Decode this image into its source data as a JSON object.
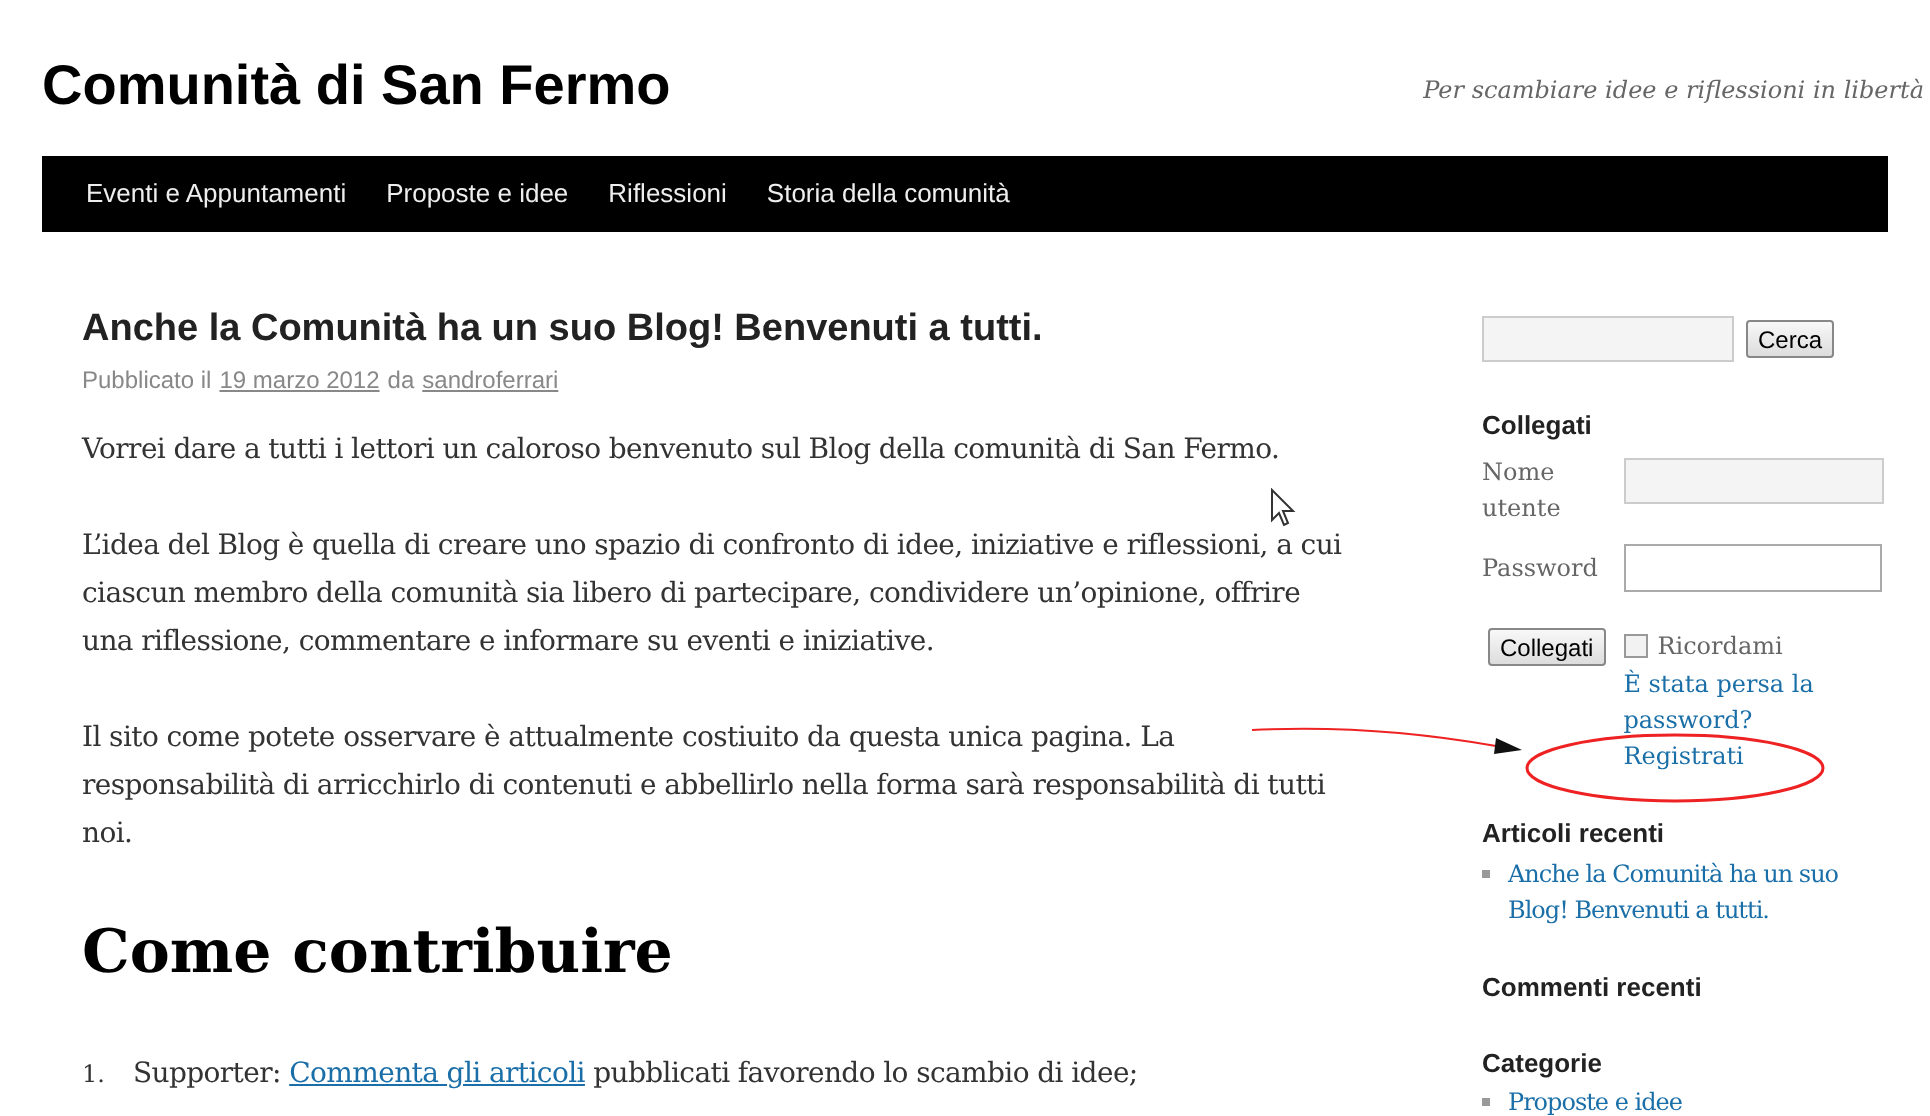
{
  "site": {
    "title": "Comunità di San Fermo",
    "tagline": "Per scambiare idee e riflessioni in libertà"
  },
  "nav": [
    {
      "label": "Eventi e Appuntamenti"
    },
    {
      "label": "Proposte e idee"
    },
    {
      "label": "Riflessioni"
    },
    {
      "label": "Storia della comunità"
    }
  ],
  "post": {
    "title": "Anche la Comunità ha un suo Blog! Benvenuti a tutti.",
    "meta_prefix": "Pubblicato il",
    "date": "19 marzo 2012",
    "meta_by": "da",
    "author": "sandroferrari",
    "paragraphs": [
      "Vorrei dare a tutti i lettori un caloroso benvenuto sul Blog della comunità di San Fermo.",
      "L’idea del Blog è quella di creare uno spazio di confronto di idee, iniziative e riflessioni, a cui ciascun membro della comunità sia libero di partecipare,  condividere un’opinione, offrire una riflessione, commentare e informare su eventi e iniziative.",
      "Il sito come potete osservare è attualmente costiuito da questa unica pagina. La responsabilità di arricchirlo di contenuti e abbellirlo nella forma sarà responsabilità di tutti noi."
    ],
    "heading": "Come contribuire",
    "list": [
      {
        "number": "1.",
        "before": "Supporter:",
        "link": "Commenta gli articoli",
        "after": "pubblicati favorendo lo scambio di idee;"
      }
    ]
  },
  "sidebar": {
    "search_button": "Cerca",
    "login": {
      "title": "Collegati",
      "username_label": "Nome utente",
      "password_label": "Password",
      "button": "Collegati",
      "remember": {
        "label": "Ricordami",
        "checked": false
      },
      "lost_password": "È stata persa la password?",
      "register": "Registrati"
    },
    "recent_posts": {
      "title": "Articoli recenti",
      "items": [
        "Anche la Comunità ha un suo Blog! Benvenuti a tutti."
      ]
    },
    "recent_comments": {
      "title": "Commenti recenti"
    },
    "categories": {
      "title": "Categorie",
      "items": [
        "Proposte e idee"
      ]
    }
  }
}
